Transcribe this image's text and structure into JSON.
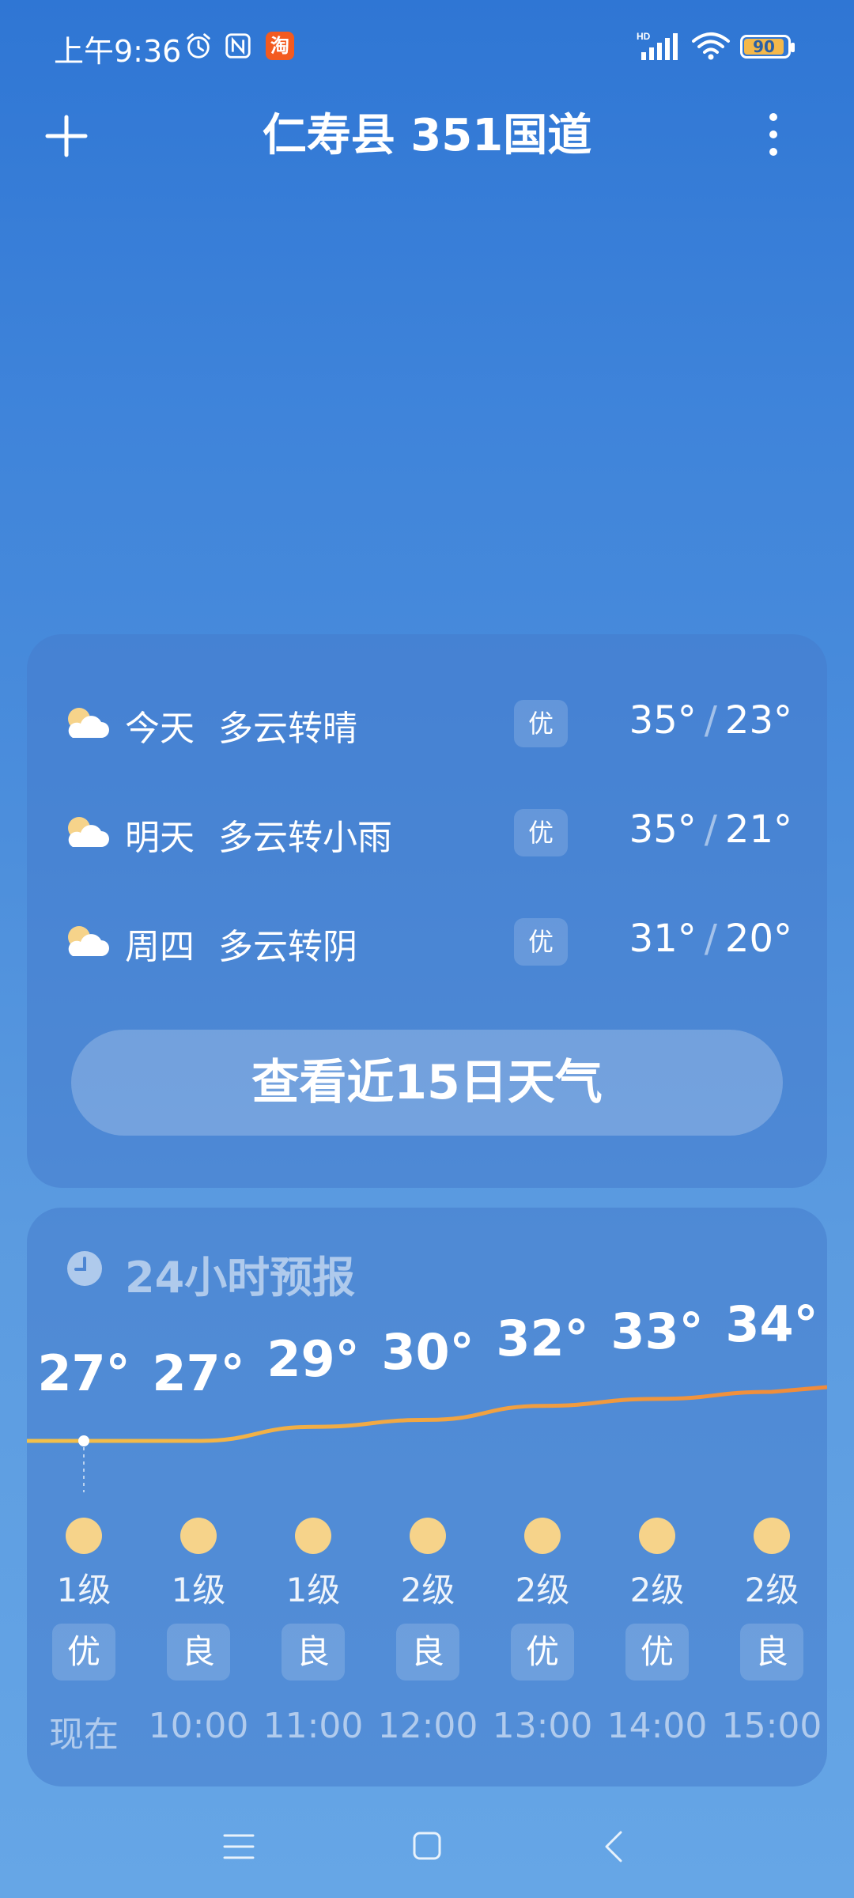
{
  "status_bar": {
    "time": "上午9:36",
    "icons": [
      "alarm-icon",
      "nfc-icon",
      "taobao-icon",
      "hd-signal-icon",
      "wifi-icon",
      "battery-icon"
    ],
    "taobao_label": "淘",
    "hd_label": "HD",
    "battery_level": "90"
  },
  "header": {
    "location": "仁寿县 351国道"
  },
  "daily": {
    "items": [
      {
        "day": "今天",
        "condition": "多云转晴",
        "aqi": "优",
        "high": "35°",
        "low": "23°"
      },
      {
        "day": "明天",
        "condition": "多云转小雨",
        "aqi": "优",
        "high": "35°",
        "low": "21°"
      },
      {
        "day": "周四",
        "condition": "多云转阴",
        "aqi": "优",
        "high": "31°",
        "low": "20°"
      }
    ],
    "more_button": "查看近15日天气"
  },
  "hourly": {
    "title": "24小时预报",
    "items": [
      {
        "temp": "27°",
        "temp_value": 27,
        "wind": "1级",
        "aqi": "优",
        "time": "现在"
      },
      {
        "temp": "27°",
        "temp_value": 27,
        "wind": "1级",
        "aqi": "良",
        "time": "10:00"
      },
      {
        "temp": "29°",
        "temp_value": 29,
        "wind": "1级",
        "aqi": "良",
        "time": "11:00"
      },
      {
        "temp": "30°",
        "temp_value": 30,
        "wind": "2级",
        "aqi": "良",
        "time": "12:00"
      },
      {
        "temp": "32°",
        "temp_value": 32,
        "wind": "2级",
        "aqi": "优",
        "time": "13:00"
      },
      {
        "temp": "33°",
        "temp_value": 33,
        "wind": "2级",
        "aqi": "优",
        "time": "14:00"
      },
      {
        "temp": "34°",
        "temp_value": 34,
        "wind": "2级",
        "aqi": "良",
        "time": "15:00"
      }
    ]
  },
  "colors": {
    "curve_start": "#f2c14b",
    "curve_end": "#f08a3a",
    "sun": "#f6d38a"
  }
}
